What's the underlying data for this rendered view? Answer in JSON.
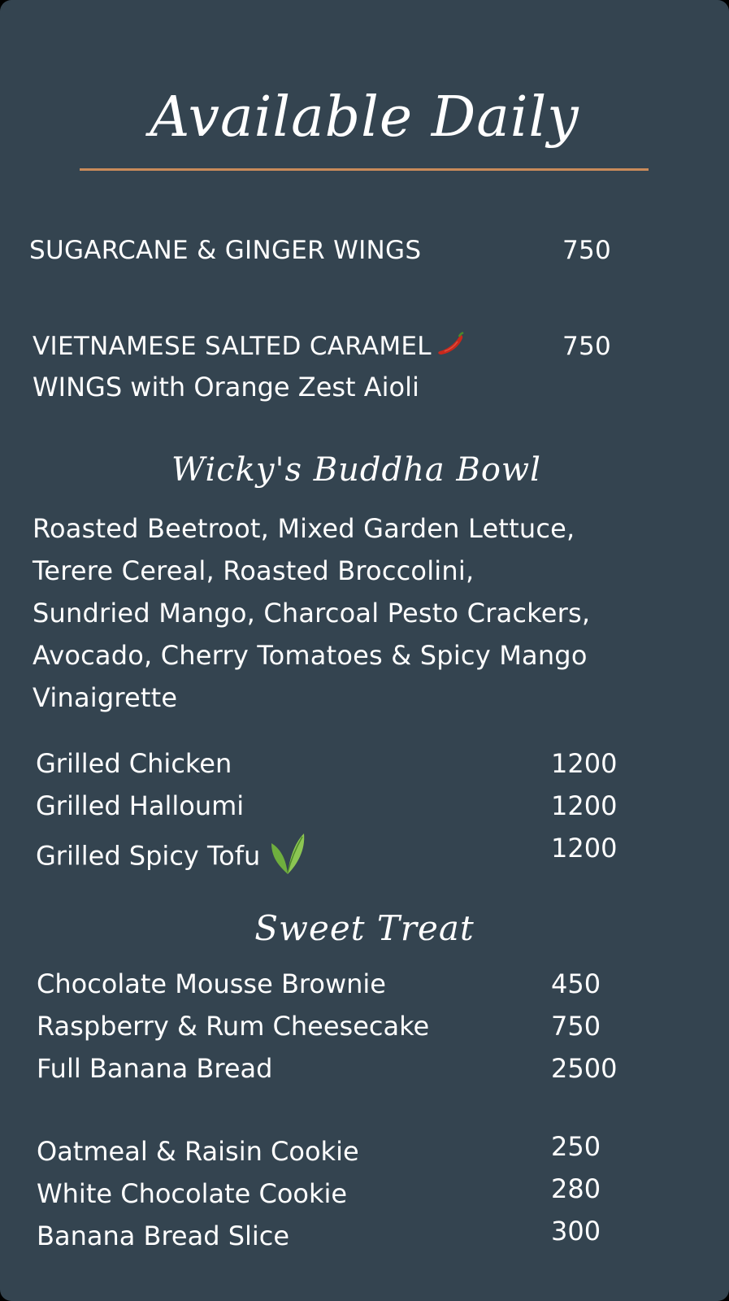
{
  "title": "Available Daily",
  "colors": {
    "background": "#344450",
    "rule": "#c98b5a",
    "text": "#ffffff",
    "chili": "#c8281c",
    "leaf": "#7ab648"
  },
  "wings": [
    {
      "name": "SUGARCANE & GINGER WINGS",
      "price": "750"
    },
    {
      "name_line1": "VIETNAMESE SALTED CARAMEL",
      "name_line2": "WINGS with Orange Zest Aioli",
      "price": "750",
      "icon": "chili-pepper-icon"
    }
  ],
  "buddha_bowl": {
    "heading": "Wicky's Buddha Bowl",
    "description": [
      "Roasted Beetroot, Mixed Garden Lettuce,",
      "Terere Cereal, Roasted Broccolini,",
      "Sundried Mango, Charcoal Pesto Crackers,",
      "Avocado, Cherry Tomatoes & Spicy Mango",
      "Vinaigrette"
    ],
    "options": [
      {
        "name": "Grilled Chicken",
        "price": "1200"
      },
      {
        "name": "Grilled Halloumi",
        "price": "1200"
      },
      {
        "name": "Grilled Spicy Tofu",
        "price": "1200",
        "icon": "vegan-leaf-icon"
      }
    ]
  },
  "sweet_treat": {
    "heading": "Sweet Treat",
    "items": [
      {
        "name": "Chocolate Mousse Brownie",
        "price": "450"
      },
      {
        "name": "Raspberry & Rum Cheesecake",
        "price": "750"
      },
      {
        "name": "Full Banana Bread",
        "price": "2500"
      }
    ],
    "cookies": [
      {
        "name": "Oatmeal & Raisin Cookie",
        "price": "250"
      },
      {
        "name": "White Chocolate Cookie",
        "price": "280"
      },
      {
        "name": "Banana Bread Slice",
        "price": "300"
      }
    ]
  }
}
